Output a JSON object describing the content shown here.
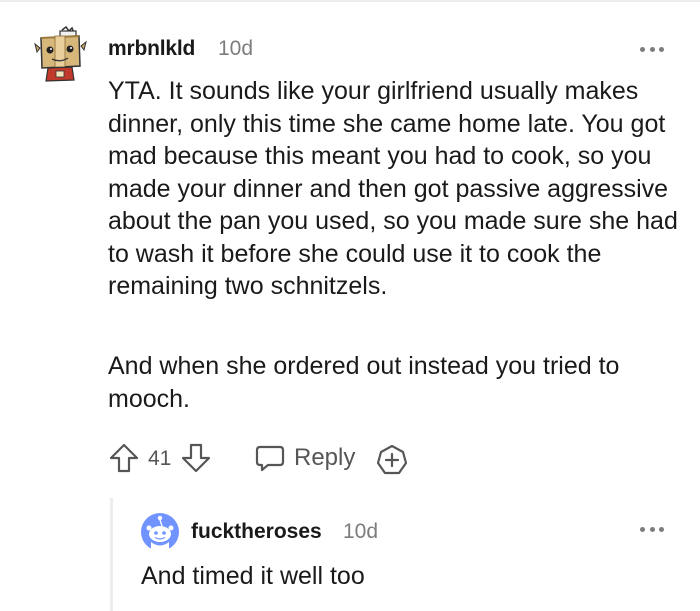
{
  "comment": {
    "author": "mrbnlkld",
    "age": "10d",
    "paragraphs": [
      "YTA. It sounds like your girlfriend usually makes dinner, only this time she came home late. You got mad because this meant you had to cook, so you made your dinner and then got passive aggressive about the pan you used, so you made sure she had to wash it before she could use it to cook the remaining two schnitzels.",
      "And when she ordered out instead you tried to mooch."
    ],
    "score": "41",
    "reply_label": "Reply",
    "avatar_icon": "box-head-robot-avatar-icon"
  },
  "reply": {
    "author": "fucktheroses",
    "age": "10d",
    "text": "And timed it well too",
    "avatar_icon": "default-snoo-avatar-icon"
  },
  "colors": {
    "text": "#1a1a1b",
    "muted": "#7c7c7c",
    "action": "#565656",
    "divider": "#ededed",
    "snoo_bg": "#7193ff"
  }
}
